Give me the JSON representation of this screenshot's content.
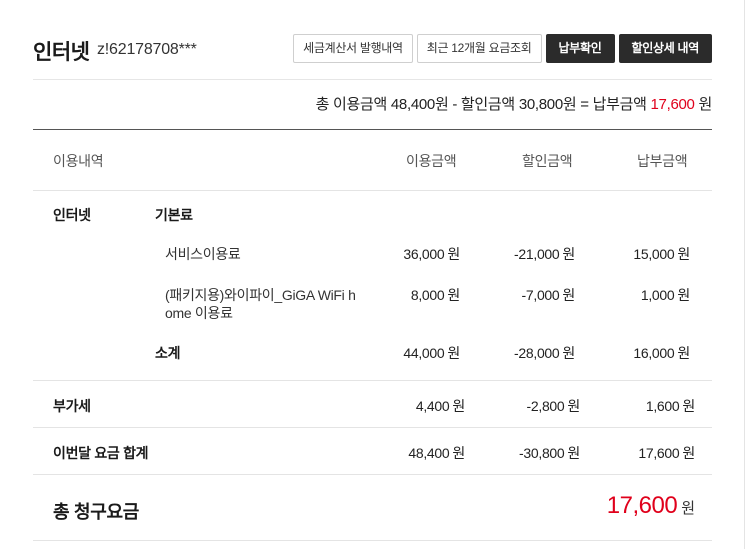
{
  "header": {
    "title": "인터넷",
    "account": "z!62178708***",
    "buttons": {
      "tax_invoice": "세금계산서 발행내역",
      "recent_12": "최근 12개월 요금조회",
      "payment_check": "납부확인",
      "discount_detail": "할인상세 내역"
    }
  },
  "summary": {
    "prefix": "총 이용금액",
    "usage_amount": "48,400",
    "won1": "원",
    "minus": " - ",
    "discount_label": "할인금액",
    "discount_amount": "30,800",
    "won2": "원",
    "equals": " = ",
    "pay_label": "납부금액",
    "pay_amount": "17,600",
    "won3": "원"
  },
  "table": {
    "headers": {
      "detail": "이용내역",
      "usage": "이용금액",
      "discount": "할인금액",
      "payment": "납부금액"
    },
    "unit": "원",
    "section_internet": "인터넷",
    "group_basic": "기본료",
    "rows": [
      {
        "item": "서비스이용료",
        "usage": "36,000",
        "discount": "-21,000",
        "payment": "15,000"
      },
      {
        "item_line1": "(패키지용)와이파이_GiGA WiFi h",
        "item_line2": "ome 이용료",
        "usage": "8,000",
        "discount": "-7,000",
        "payment": "1,000"
      }
    ],
    "subtotal": {
      "label": "소계",
      "usage": "44,000",
      "discount": "-28,000",
      "payment": "16,000"
    },
    "vat": {
      "label": "부가세",
      "usage": "4,400",
      "discount": "-2,800",
      "payment": "1,600"
    },
    "month_total": {
      "label": "이번달 요금 합계",
      "usage": "48,400",
      "discount": "-30,800",
      "payment": "17,600"
    }
  },
  "grand_total": {
    "label": "총 청구요금",
    "amount": "17,600",
    "unit": "원"
  },
  "colors": {
    "accent_red": "#e0001b",
    "dark_button": "#2b2b2b"
  }
}
